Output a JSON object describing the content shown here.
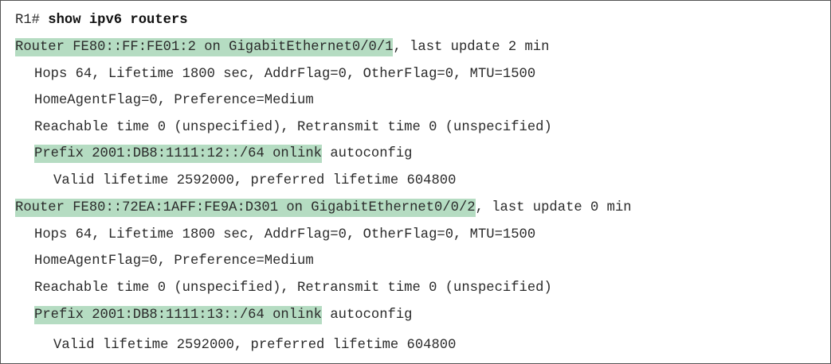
{
  "prompt": "R1#",
  "command": "show ipv6 routers",
  "colors": {
    "highlight": "#b5dcc2",
    "text": "#2b2b2b",
    "border": "#555555"
  },
  "routers": [
    {
      "header_hl": "Router FE80::FF:FE01:2 on GigabitEthernet0/0/1",
      "header_rest": ", last update 2 min",
      "hops": "Hops 64, Lifetime 1800 sec, AddrFlag=0, OtherFlag=0, MTU=1500",
      "flags": "HomeAgentFlag=0, Preference=Medium",
      "reach": "Reachable time 0 (unspecified), Retransmit time 0 (unspecified)",
      "prefix_hl": "Prefix 2001:DB8:1111:12::/64 onlink",
      "prefix_rest": " autoconfig",
      "valid": "Valid lifetime 2592000, preferred lifetime 604800"
    },
    {
      "header_hl": "Router FE80::72EA:1AFF:FE9A:D301 on GigabitEthernet0/0/2",
      "header_rest": ", last update 0 min",
      "hops": "Hops 64, Lifetime 1800 sec, AddrFlag=0, OtherFlag=0, MTU=1500",
      "flags": "HomeAgentFlag=0, Preference=Medium",
      "reach": "Reachable time 0 (unspecified), Retransmit time 0 (unspecified)",
      "prefix_hl": "Prefix 2001:DB8:1111:13::/64 onlink",
      "prefix_rest": " autoconfig",
      "valid": "Valid lifetime 2592000, preferred lifetime 604800"
    }
  ]
}
